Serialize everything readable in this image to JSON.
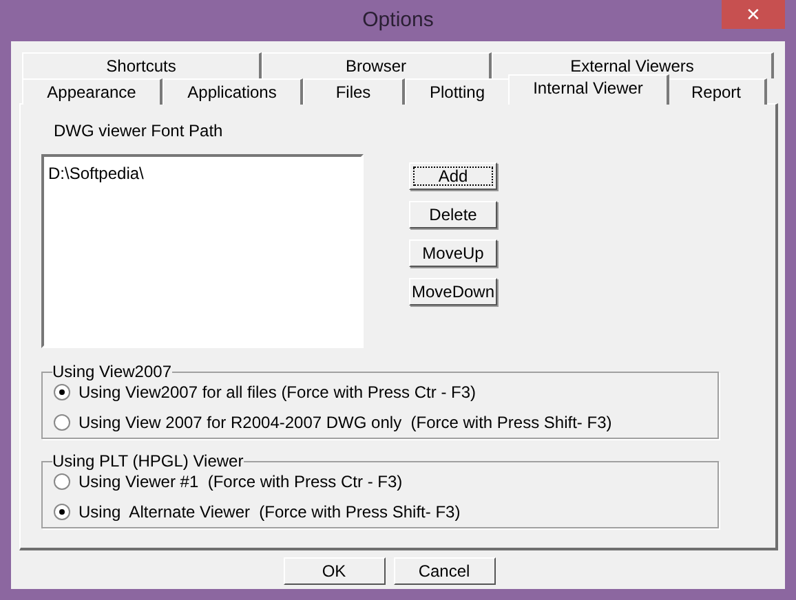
{
  "window": {
    "title": "Options",
    "close": "✕"
  },
  "tab_rows": [
    [
      {
        "label": "Shortcuts",
        "selected": false
      },
      {
        "label": "Browser",
        "selected": false
      },
      {
        "label": "External Viewers",
        "selected": false
      }
    ],
    [
      {
        "label": "Appearance",
        "selected": false
      },
      {
        "label": "Applications",
        "selected": false
      },
      {
        "label": "Files",
        "selected": false
      },
      {
        "label": "Plotting",
        "selected": false
      },
      {
        "label": "Internal Viewer",
        "selected": true
      },
      {
        "label": "Report",
        "selected": false
      }
    ]
  ],
  "font_path": {
    "label": "DWG viewer Font Path",
    "items": [
      "D:\\Softpedia\\"
    ],
    "buttons": [
      {
        "label": "Add",
        "focused": true
      },
      {
        "label": "Delete",
        "focused": false
      },
      {
        "label": "MoveUp",
        "focused": false
      },
      {
        "label": "MoveDown",
        "focused": false
      }
    ]
  },
  "groups": [
    {
      "title": "Using View2007",
      "options": [
        {
          "label": "Using View2007 for all files (Force with Press Ctr - F3)",
          "selected": true
        },
        {
          "label": "Using View 2007 for R2004-2007 DWG only  (Force with Press Shift- F3)",
          "selected": false
        }
      ]
    },
    {
      "title": "Using PLT (HPGL) Viewer",
      "options": [
        {
          "label": "Using Viewer #1  (Force with Press Ctr - F3)",
          "selected": false
        },
        {
          "label": "Using  Alternate Viewer  (Force with Press Shift- F3)",
          "selected": true
        }
      ]
    }
  ],
  "footer_buttons": [
    "OK",
    "Cancel"
  ]
}
